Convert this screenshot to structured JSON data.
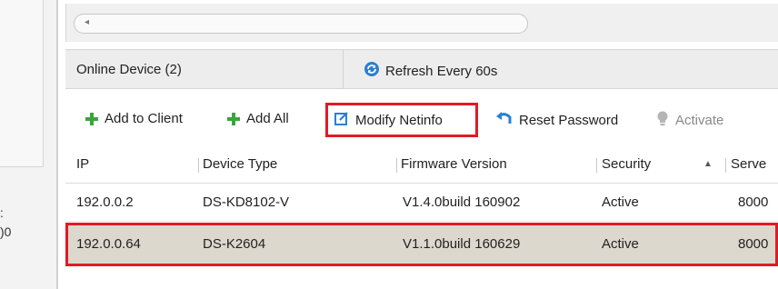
{
  "left_panel": {
    "text_1": ":",
    "text_2": ")0"
  },
  "tabs": {
    "online_device": "Online Device (2)",
    "refresh": "Refresh Every 60s"
  },
  "toolbar": {
    "add_to_client": "Add to Client",
    "add_all": "Add All",
    "modify_netinfo": "Modify Netinfo",
    "reset_password": "Reset Password",
    "activate": "Activate"
  },
  "table": {
    "columns": [
      "IP",
      "Device Type",
      "Firmware Version",
      "Security",
      "Serve"
    ],
    "sort_indicator": "▲",
    "rows": [
      {
        "ip": "192.0.0.2",
        "device_type": "DS-KD8102-V",
        "firmware": "V1.4.0build 160902",
        "security": "Active",
        "port": "8000"
      },
      {
        "ip": "192.0.0.64",
        "device_type": "DS-K2604",
        "firmware": "V1.1.0build 160629",
        "security": "Active",
        "port": "8000"
      }
    ]
  },
  "colors": {
    "highlight": "#e01b24",
    "selected_row": "#ddd8ce",
    "add_icon": "#3aa53a",
    "link_blue": "#2a7fd4"
  },
  "icons": {
    "add": "plus-icon",
    "refresh": "refresh-icon",
    "modify": "edit-icon",
    "reset": "undo-icon",
    "activate": "bulb-icon"
  }
}
